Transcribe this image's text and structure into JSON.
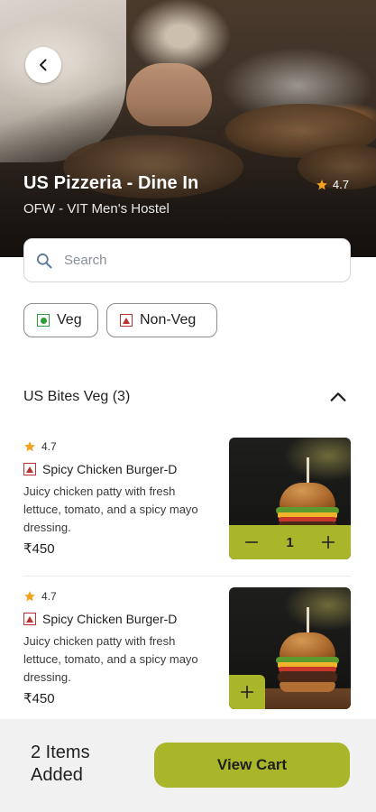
{
  "restaurant": {
    "name": "US Pizzeria - Dine In",
    "location": "OFW - VIT Men's Hostel",
    "rating": "4.7"
  },
  "search": {
    "placeholder": "Search"
  },
  "filters": [
    {
      "label": "Veg",
      "icon": "veg-indicator-icon"
    },
    {
      "label": "Non-Veg",
      "icon": "nonveg-indicator-icon"
    }
  ],
  "section": {
    "title": "US Bites Veg (3)",
    "toggle_icon": "chevron-up-icon"
  },
  "items": [
    {
      "rating": "4.7",
      "name": "Spicy Chicken Burger-D",
      "description": "Juicy chicken patty with fresh lettuce, tomato, and a spicy mayo dressing.",
      "price": "₹450",
      "quantity": "1",
      "image": "burger-image"
    },
    {
      "rating": "4.7",
      "name": "Spicy Chicken Burger-D",
      "description": "Juicy chicken patty with fresh lettuce, tomato, and a spicy mayo dressing.",
      "price": "₹450",
      "image": "burger-image"
    }
  ],
  "cart": {
    "items_added": "2 Items Added",
    "button_label": "View Cart"
  },
  "colors": {
    "accent": "#a9b629",
    "veg": "#2e9b3a",
    "nonveg": "#b7342f",
    "star": "#f2a21c"
  }
}
